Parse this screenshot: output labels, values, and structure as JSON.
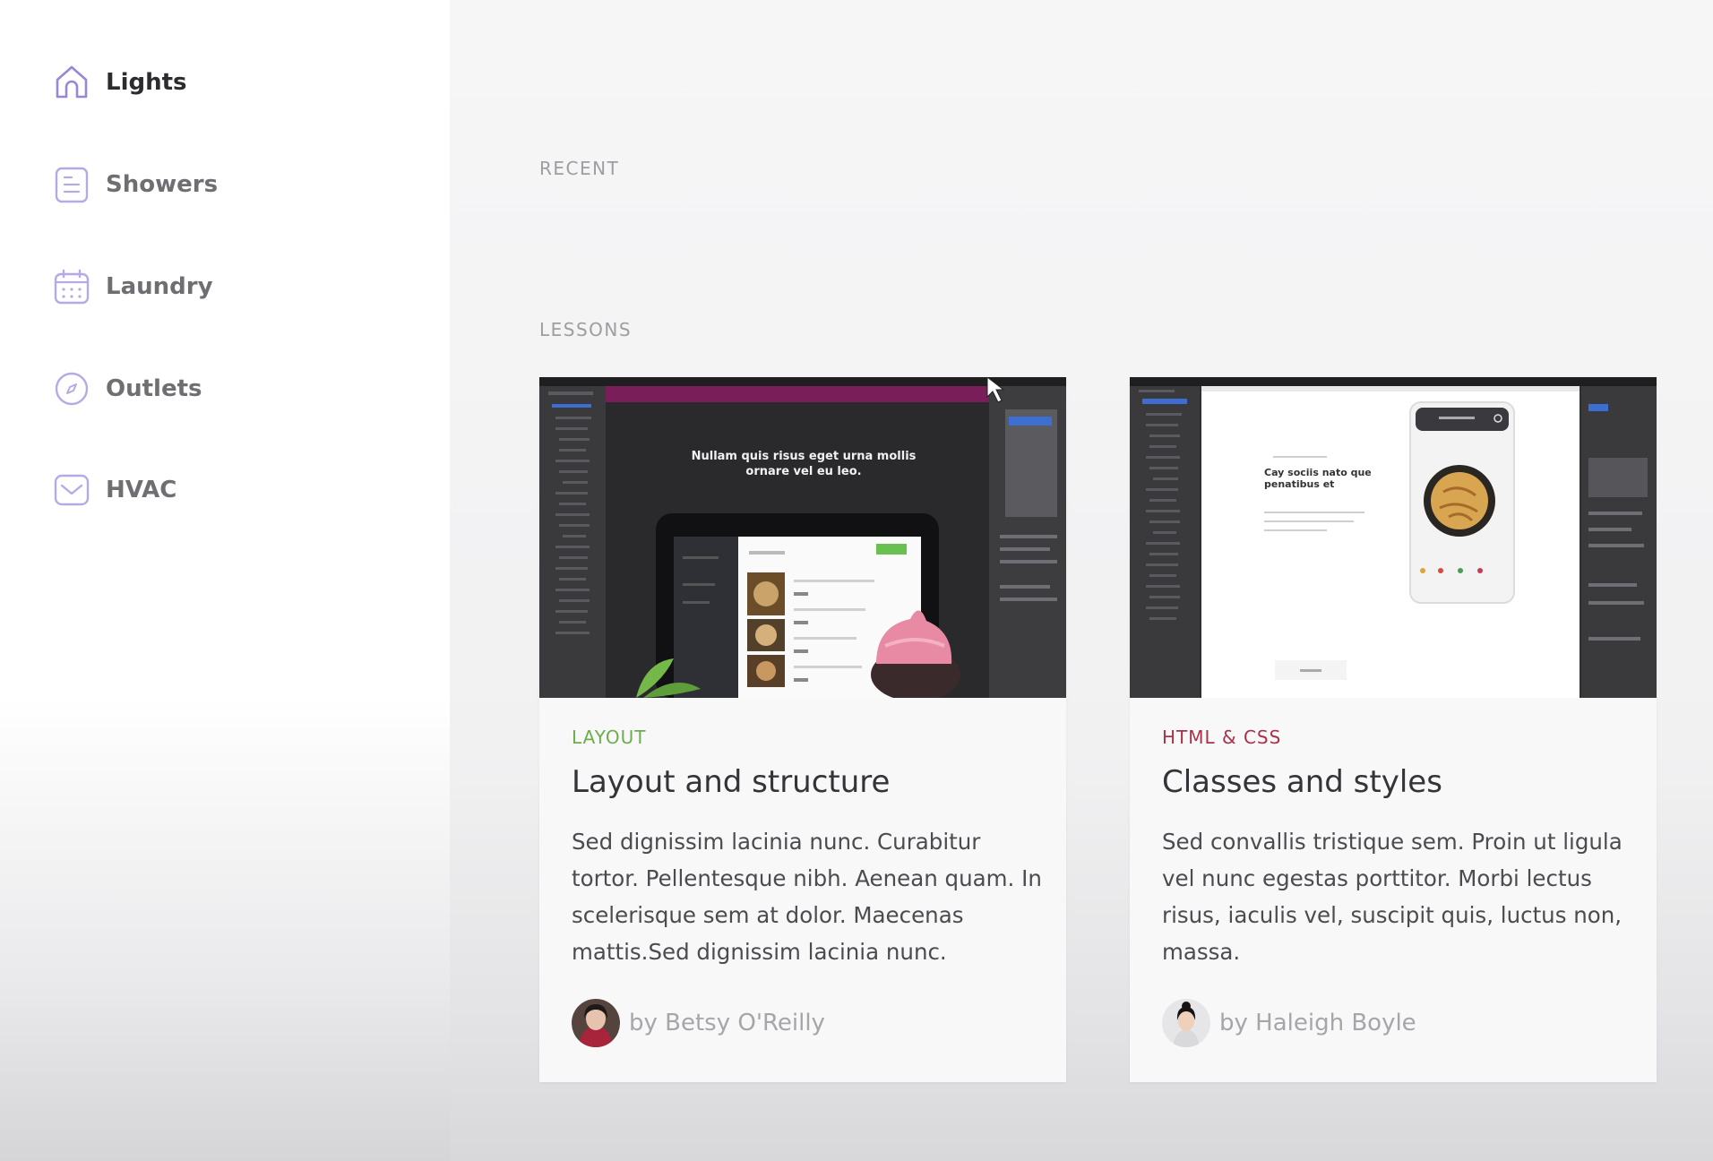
{
  "sidebar": {
    "items": [
      {
        "label": "Lights",
        "icon": "home-icon",
        "active": true
      },
      {
        "label": "Showers",
        "icon": "document-icon",
        "active": false
      },
      {
        "label": "Laundry",
        "icon": "calendar-icon",
        "active": false
      },
      {
        "label": "Outlets",
        "icon": "compass-icon",
        "active": false
      },
      {
        "label": "HVAC",
        "icon": "inbox-icon",
        "active": false
      }
    ],
    "icon_color": "#9a86d6"
  },
  "main": {
    "recent_label": "RECENT",
    "lessons_label": "LESSONS",
    "cards": [
      {
        "category": "LAYOUT",
        "category_color": "#6cae4e",
        "title": "Layout and structure",
        "description": "Sed dignissim lacinia nunc. Curabitur tortor. Pellentesque nibh. Aenean quam. In scelerisque sem at dolor. Maecenas mattis.Sed dignissim lacinia nunc.",
        "author": "by Betsy O'Reilly",
        "thumbnail_headline": "Nullam quis risus eget urna mollis ornare vel eu leo."
      },
      {
        "category": "HTML & CSS",
        "category_color": "#a8324a",
        "title": "Classes and styles",
        "description": "Sed convallis tristique sem. Proin ut ligula vel nunc egestas porttitor. Morbi lectus risus, iaculis vel, suscipit quis, luctus non, massa.",
        "author": "by Haleigh Boyle",
        "thumbnail_headline": "Cay sociis nato que penatibus et"
      }
    ]
  }
}
